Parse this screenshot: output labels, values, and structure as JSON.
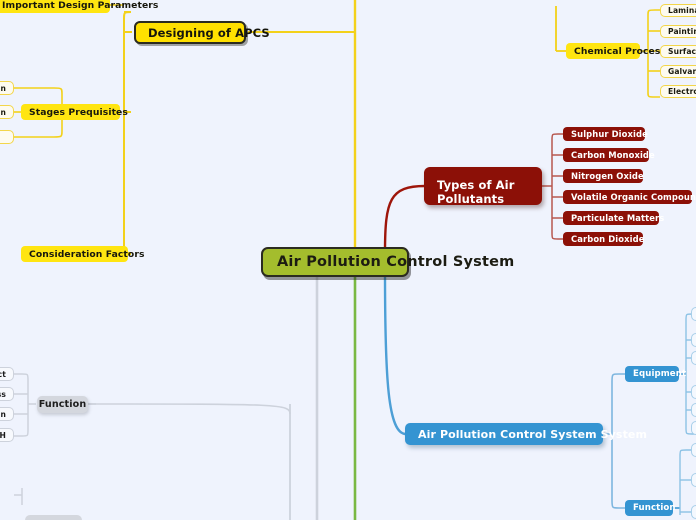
{
  "diagram": {
    "type": "mind-map",
    "background_color": "#eff3fd",
    "root": {
      "label": "Air Pollution Control System",
      "color": "#a4bd2d"
    },
    "branches": {
      "designing": {
        "label": "Designing of APCS",
        "color": "#ffe000",
        "children": [
          {
            "label": "Important Design Parameters",
            "clipped": "top-left"
          },
          {
            "label": "Stages Prequisites"
          },
          {
            "label": "Consideration Factors"
          }
        ]
      },
      "stages_prequisites_children": [
        {
          "label": "n"
        },
        {
          "label": "n"
        },
        {
          "label": ""
        }
      ],
      "chemical_process": {
        "label": "Chemical Process",
        "color": "#ffe000",
        "children": [
          {
            "label": "Laminati"
          },
          {
            "label": "Painting"
          },
          {
            "label": "Surface C"
          },
          {
            "label": "Galvaniz"
          },
          {
            "label": "Electropl"
          }
        ]
      },
      "pollutants": {
        "label": "Types of Air Pollutants",
        "label_line1": "Types of Air",
        "label_line2": "Pollutants",
        "color": "#8c1007",
        "children": [
          {
            "label": "Sulphur Dioxide"
          },
          {
            "label": "Carbon Monoxide"
          },
          {
            "label": "Nitrogen Oxide"
          },
          {
            "label": "Volatile Organic Compounds"
          },
          {
            "label": "Particulate Matters"
          },
          {
            "label": "Carbon Dioxide"
          }
        ]
      },
      "control_system": {
        "label": "Air Pollution Control System System",
        "color": "#3494d2",
        "children": [
          {
            "label": "Equipment"
          },
          {
            "label": "Function"
          }
        ]
      },
      "equipment_children": [
        {
          "label": ""
        },
        {
          "label": ""
        },
        {
          "label": ""
        },
        {
          "label": ""
        },
        {
          "label": ""
        },
        {
          "label": ""
        }
      ],
      "function_blue_children": [
        {
          "label": ""
        },
        {
          "label": ""
        },
        {
          "label": ""
        }
      ],
      "function_gray": {
        "label": "Function",
        "color": "#d4d7de",
        "children": [
          {
            "label": "duct"
          },
          {
            "label": "ness"
          },
          {
            "label": "tion"
          },
          {
            "label": "n pH"
          }
        ]
      }
    },
    "connector_colors": {
      "yellow": "#f3d11a",
      "red": "#9e150a",
      "blue": "#4d9fd6",
      "green": "#79b843",
      "gray": "#cdd2dc"
    }
  }
}
